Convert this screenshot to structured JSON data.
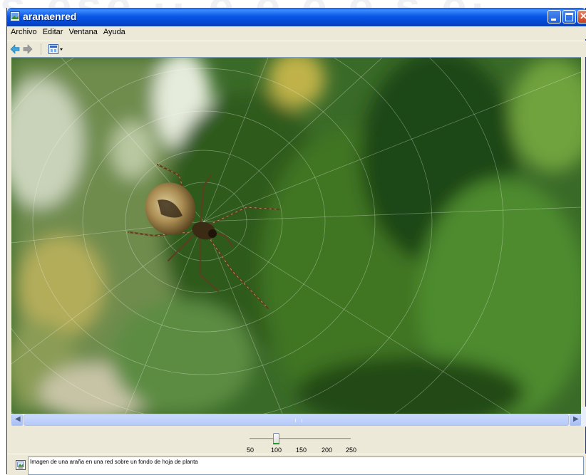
{
  "window": {
    "title": "aranaenred",
    "app_icon": "picture-icon"
  },
  "menu": {
    "items": [
      "Archivo",
      "Editar",
      "Ventana",
      "Ayuda"
    ]
  },
  "toolbar": {
    "back_icon": "arrow-left-icon",
    "forward_icon": "arrow-right-icon",
    "view_icon": "image-view-dropdown-icon"
  },
  "image": {
    "subject": "spider-on-web",
    "colors": {
      "leaf_dark": "#2f5a1f",
      "leaf_light": "#7aa34a",
      "spider": "#b89a5a"
    }
  },
  "zoom": {
    "tick_labels": [
      "50",
      "100",
      "150",
      "200",
      "250"
    ],
    "value": 100
  },
  "status": {
    "caption": "Imagen de una araña en una red sobre un fondo de hoja de planta",
    "icon": "image-info-icon"
  },
  "colors": {
    "titlebar": "#0a58e6",
    "chrome": "#ece9d8",
    "scrollbar": "#b5c9f9"
  }
}
